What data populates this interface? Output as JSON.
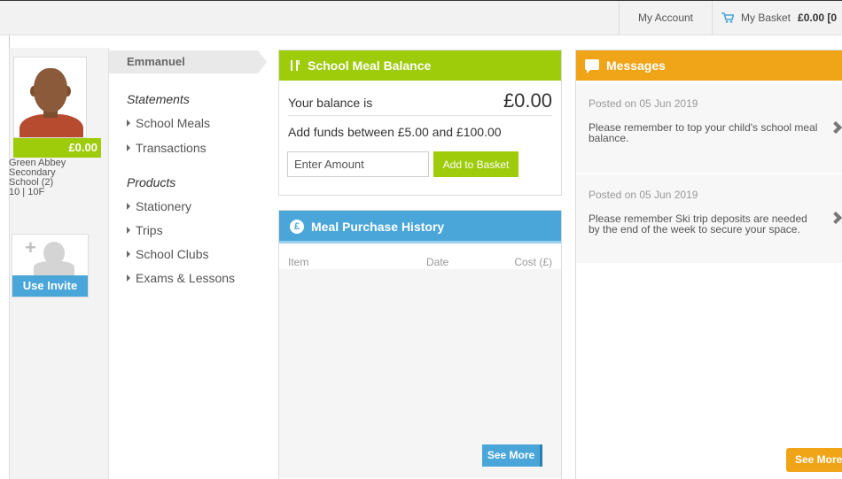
{
  "topbar": {
    "account_label": "My Account",
    "basket_label": "My Basket",
    "basket_amount": "£0.00 [0"
  },
  "child": {
    "name": "Emmanuel",
    "balance": "£0.00",
    "school_line1": "Green Abbey",
    "school_line2": "Secondary",
    "school_line3": "School (2)",
    "school_line4": "10 | 10F",
    "invite_label": "Use Invite"
  },
  "nav": {
    "statements_heading": "Statements",
    "statements": [
      "School Meals",
      "Transactions"
    ],
    "products_heading": "Products",
    "products": [
      "Stationery",
      "Trips",
      "School Clubs",
      "Exams & Lessons"
    ]
  },
  "meal_balance": {
    "title": "School Meal Balance",
    "balance_label": "Your balance is",
    "balance_value": "£0.00",
    "funds_text": "Add funds between £5.00 and £100.00",
    "amount_placeholder": "Enter Amount",
    "add_button": "Add to Basket"
  },
  "history": {
    "title": "Meal Purchase History",
    "columns": [
      "Item",
      "Date",
      "Cost (£)"
    ],
    "see_more": "See More"
  },
  "messages": {
    "title": "Messages",
    "items": [
      {
        "date": "Posted on 05 Jun 2019",
        "text": "Please remember to top your child's school meal balance."
      },
      {
        "date": "Posted on 05 Jun 2019",
        "text": "Please remember Ski trip deposits are needed by the end of the week to secure your space."
      }
    ],
    "see_more": "See More"
  },
  "colors": {
    "green": "#9ecb0a",
    "blue": "#4aa6d9",
    "orange": "#f0a418"
  },
  "icons": [
    "cart-icon",
    "cutlery-icon",
    "pound-coin-icon",
    "speech-bubble-icon",
    "chevron-right-icon",
    "plus-icon",
    "person-icon"
  ]
}
